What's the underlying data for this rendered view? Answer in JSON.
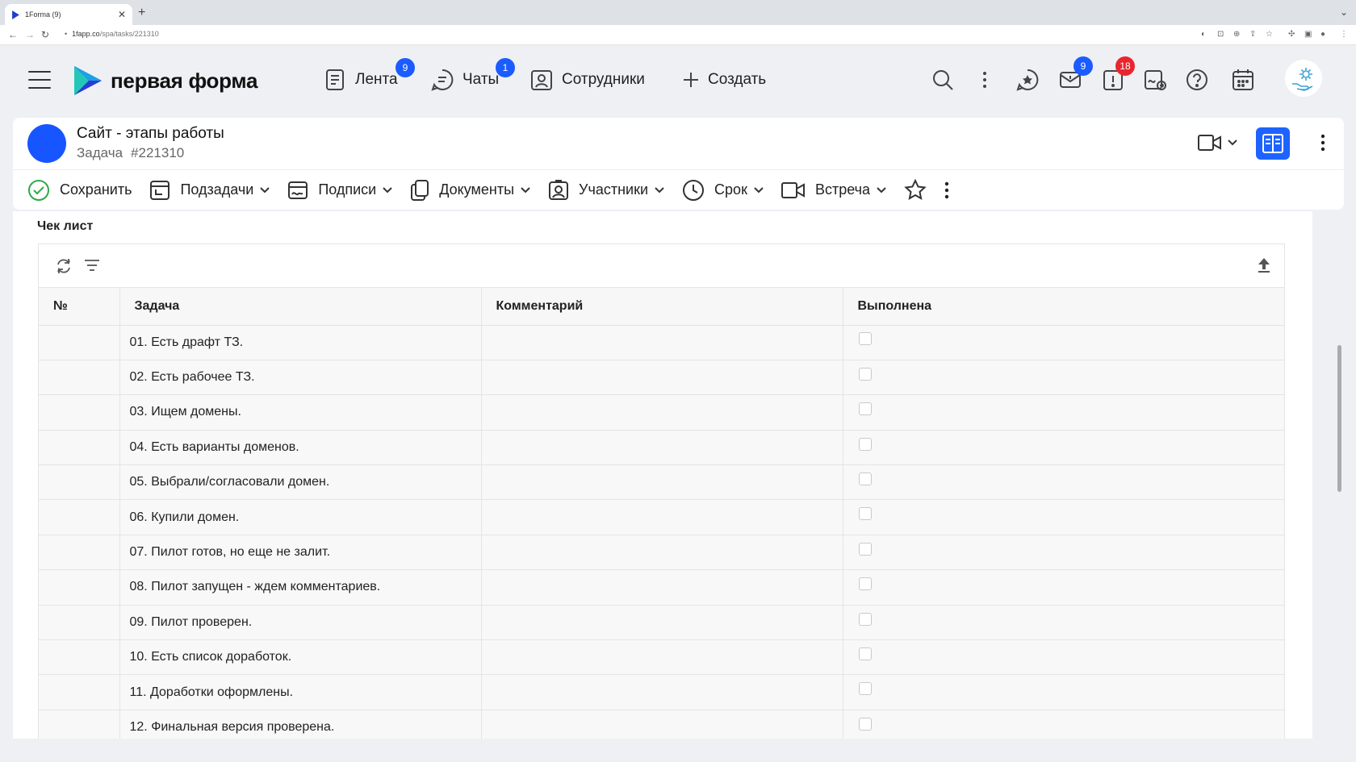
{
  "browser": {
    "tab_title": "1Forma (9)",
    "url_host": "1fapp.co",
    "url_path": "/spa/tasks/221310"
  },
  "header": {
    "logo_text": "первая форма",
    "nav": [
      {
        "label": "Лента",
        "badge": "9"
      },
      {
        "label": "Чаты",
        "badge": "1"
      },
      {
        "label": "Сотрудники"
      },
      {
        "label": "Создать"
      }
    ],
    "icon_badges": {
      "tasks": "9",
      "alerts": "18"
    }
  },
  "task": {
    "title": "Сайт - этапы работы",
    "type": "Задача",
    "number": "#221310"
  },
  "toolbar": {
    "save": "Сохранить",
    "subtasks": "Подзадачи",
    "signatures": "Подписи",
    "documents": "Документы",
    "participants": "Участники",
    "deadline": "Срок",
    "meeting": "Встреча"
  },
  "checklist": {
    "title": "Чек лист",
    "columns": [
      "№",
      "Задача",
      "Комментарий",
      "Выполнена"
    ],
    "rows": [
      {
        "task": "01. Есть драфт ТЗ.",
        "comment": "",
        "done": false
      },
      {
        "task": "02. Есть рабочее ТЗ.",
        "comment": "",
        "done": false
      },
      {
        "task": "03. Ищем домены.",
        "comment": "",
        "done": false
      },
      {
        "task": "04. Есть варианты доменов.",
        "comment": "",
        "done": false
      },
      {
        "task": "05. Выбрали/согласовали домен.",
        "comment": "",
        "done": false
      },
      {
        "task": "06. Купили домен.",
        "comment": "",
        "done": false
      },
      {
        "task": "07. Пилот готов, но еще не залит.",
        "comment": "",
        "done": false
      },
      {
        "task": "08. Пилот запущен - ждем комментариев.",
        "comment": "",
        "done": false
      },
      {
        "task": "09. Пилот проверен.",
        "comment": "",
        "done": false
      },
      {
        "task": "10. Есть список доработок.",
        "comment": "",
        "done": false
      },
      {
        "task": "11. Доработки оформлены.",
        "comment": "",
        "done": false
      },
      {
        "task": "12. Финальная версия проверена.",
        "comment": "",
        "done": false
      }
    ]
  },
  "colors": {
    "accent": "#1d63ff",
    "badge_blue": "#1a5cff",
    "badge_red": "#e8262e",
    "avatar": "#1755ff",
    "save_green": "#2eaa4a"
  }
}
